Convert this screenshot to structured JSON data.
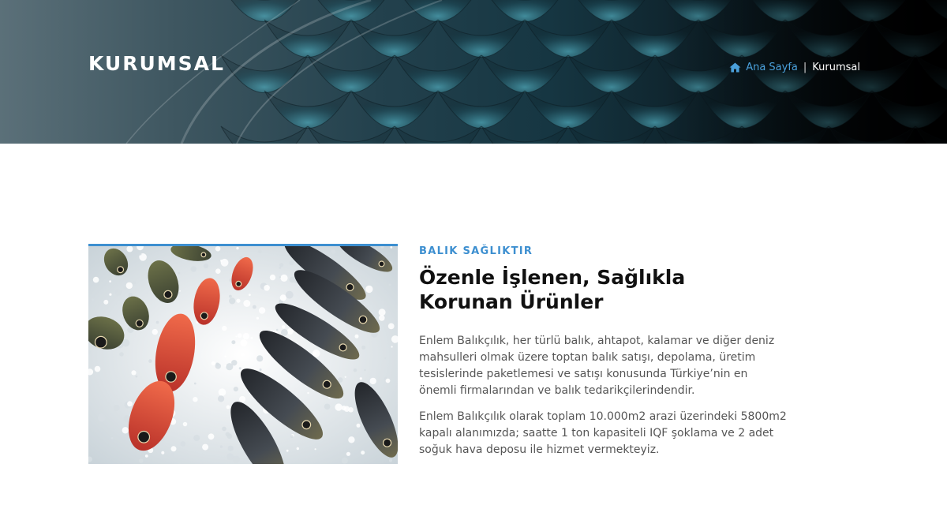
{
  "hero": {
    "title": "KURUMSAL",
    "breadcrumb": {
      "home_icon": "home-icon",
      "home_label": "Ana Sayfa",
      "separator": "|",
      "current": "Kurumsal"
    }
  },
  "about": {
    "image_alt": "Buz üzerinde taze balıklar",
    "eyebrow": "BALIK SAĞLIKTIR",
    "heading": "Özenle İşlenen, Sağlıkla Korunan Ürünler",
    "paragraphs": [
      "Enlem Balıkçılık, her türlü balık, ahtapot, kalamar ve diğer deniz mahsulleri olmak üzere toptan balık satışı, depolama, üretim tesislerinde paketlemesi ve satışı konusunda Türkiye’nin en önemli firmalarından ve balık tedarikçilerindendir.",
      "Enlem Balıkçılık olarak toplam 10.000m2 arazi üzerindeki 5800m2 kapalı alanımızda; saatte 1 ton kapasiteli IQF şoklama ve 2 adet soğuk hava deposu ile hizmet vermekteyiz."
    ]
  },
  "colors": {
    "accent": "#3d8fd0",
    "heading": "#111111",
    "body_text": "#555555"
  }
}
